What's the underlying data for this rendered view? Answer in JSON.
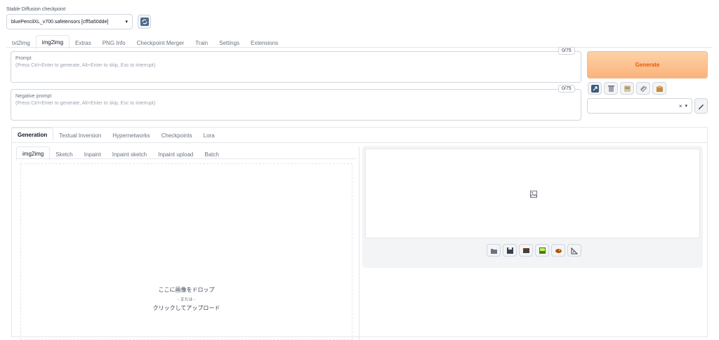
{
  "checkpoint": {
    "label": "Stable Diffusion checkpoint",
    "value": "bluePencilXL_v700.safetensors [cff5a50dde]",
    "dropdown_icon": "chevron-down-icon",
    "refresh_icon": "refresh-icon"
  },
  "main_tabs": [
    {
      "label": "txt2img"
    },
    {
      "label": "img2img"
    },
    {
      "label": "Extras"
    },
    {
      "label": "PNG Info"
    },
    {
      "label": "Checkpoint Merger"
    },
    {
      "label": "Train"
    },
    {
      "label": "Settings"
    },
    {
      "label": "Extensions"
    }
  ],
  "prompt": {
    "title": "Prompt",
    "placeholder": "(Press Ctrl+Enter to generate, Alt+Enter to skip, Esc to interrupt)",
    "counter": "0/75"
  },
  "negative_prompt": {
    "title": "Negative prompt",
    "placeholder": "(Press Ctrl+Enter to generate, Alt+Enter to skip, Esc to interrupt)",
    "counter": "0/75"
  },
  "generate": {
    "label": "Generate"
  },
  "style_tools": [
    {
      "icon": "arrow-read-icon"
    },
    {
      "icon": "trash-icon"
    },
    {
      "icon": "clipboard-icon"
    },
    {
      "icon": "paperclip-icon"
    },
    {
      "icon": "box-icon"
    }
  ],
  "styles_select": {
    "clear_icon": "clear-icon",
    "chevron_icon": "chevron-down-icon"
  },
  "edit_styles_icon": "pencil-icon",
  "sub_tabs": [
    {
      "label": "Generation"
    },
    {
      "label": "Textual Inversion"
    },
    {
      "label": "Hypernetworks"
    },
    {
      "label": "Checkpoints"
    },
    {
      "label": "Lora"
    }
  ],
  "image_tabs": [
    {
      "label": "img2img"
    },
    {
      "label": "Sketch"
    },
    {
      "label": "Inpaint"
    },
    {
      "label": "Inpaint sketch"
    },
    {
      "label": "Inpaint upload"
    },
    {
      "label": "Batch"
    }
  ],
  "dropzone": {
    "line1": "ここに画像をドロップ",
    "line2": "- または -",
    "line3": "クリックしてアップロード"
  },
  "output": {
    "placeholder_icon": "image-icon",
    "actions": [
      {
        "icon": "folder-icon"
      },
      {
        "icon": "save-icon"
      },
      {
        "icon": "zip-icon"
      },
      {
        "icon": "send-to-img2img-icon"
      },
      {
        "icon": "send-to-inpaint-icon"
      },
      {
        "icon": "send-to-extras-icon"
      }
    ]
  },
  "colors": {
    "accent": "#f97316",
    "generate_bg": "#fdc49a",
    "border": "#e5e7eb"
  }
}
